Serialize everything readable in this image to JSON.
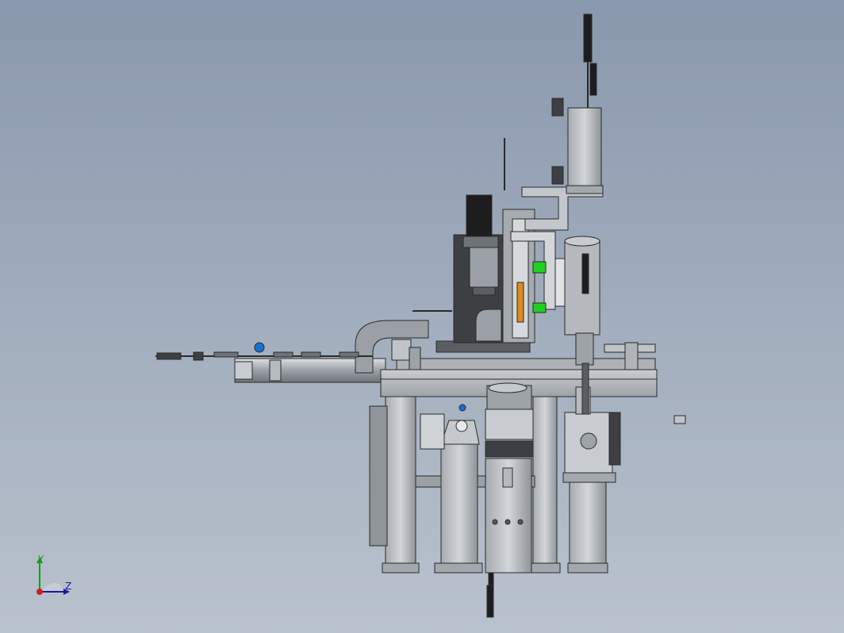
{
  "viewport": {
    "background_top": "#8a98ad",
    "background_bottom": "#b9c2cd",
    "model_colors": {
      "frame": "#b4b8bc",
      "frame_dark": "#8d9196",
      "edge": "#2a2a2a",
      "dark_part": "#3d3f42",
      "motor": "#1d1d1f",
      "accent_green": "#1fd11f",
      "accent_orange": "#e08a1a",
      "accent_blue": "#1a6fd6"
    }
  },
  "triad": {
    "y_label": "Y",
    "z_label": "Z",
    "y_color": "#1a9a1a",
    "z_color": "#1a1aa0",
    "origin_color": "#d01c1c"
  }
}
